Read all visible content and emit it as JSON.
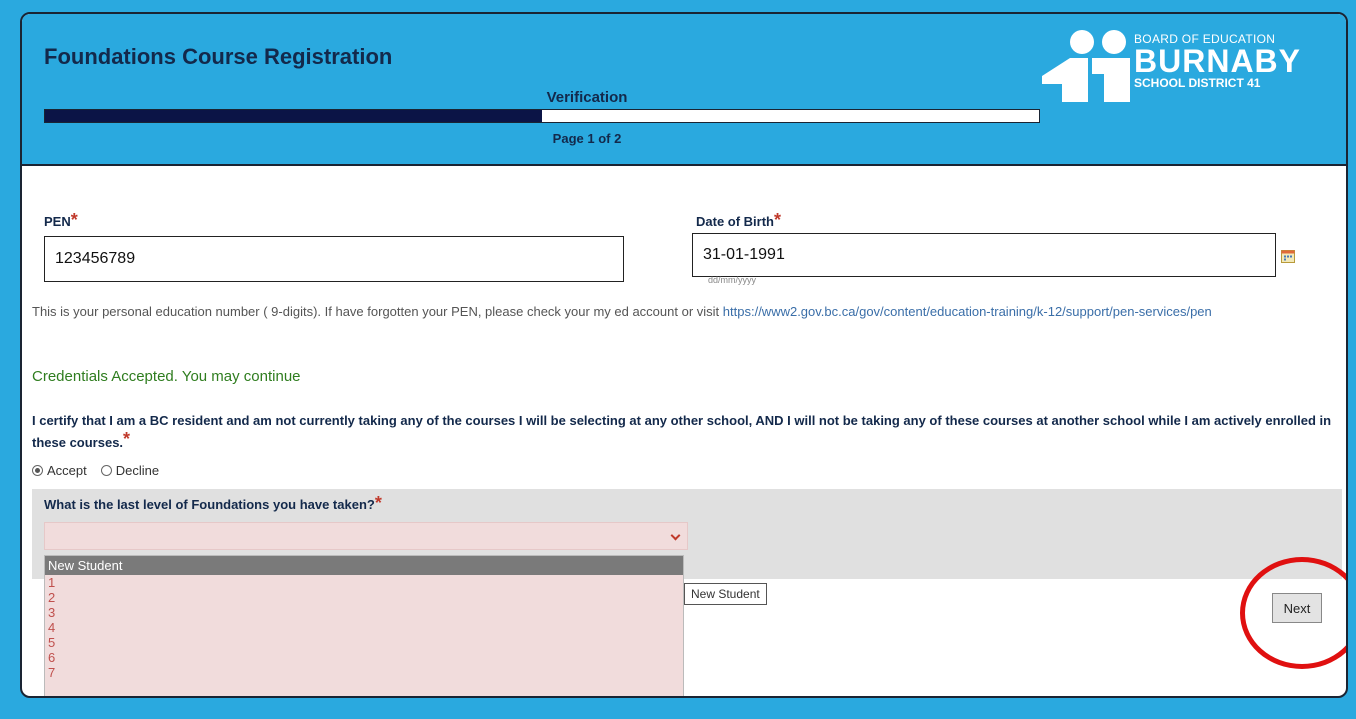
{
  "header": {
    "title": "Foundations Course Registration",
    "step_label": "Verification",
    "progress_fraction": 0.5,
    "page_label": "Page 1 of 2"
  },
  "logo": {
    "line1": "BOARD OF EDUCATION",
    "line2": "BURNABY",
    "line3": "SCHOOL DISTRICT 41"
  },
  "form": {
    "pen": {
      "label": "PEN",
      "required_mark": "*",
      "value": "123456789"
    },
    "dob": {
      "label": "Date of Birth",
      "required_mark": "*",
      "value": "31-01-1991",
      "hint": "dd/mm/yyyy",
      "icon": "calendar-icon"
    },
    "help_text": "This is your personal education number ( 9-digits). If have forgotten your PEN, please check your my ed account or visit ",
    "help_link": "https://www2.gov.bc.ca/gov/content/education-training/k-12/support/pen-services/pen",
    "status_message": "Credentials Accepted. You may continue",
    "certify": {
      "text": "I certify that I am a BC resident and am not currently taking any of the courses I will be selecting at any other school, AND I will not be taking any of these courses at another school while I am actively enrolled in these courses.",
      "required_mark": "*",
      "options": [
        "Accept",
        "Decline"
      ],
      "selected": "Accept"
    },
    "level": {
      "label": "What is the last level of Foundations you have taken?",
      "required_mark": "*",
      "selected_value": "",
      "options": [
        "New Student",
        "1",
        "2",
        "3",
        "4",
        "5",
        "6",
        "7"
      ],
      "highlighted_option": "New Student"
    },
    "tooltip": "New Student",
    "next_label": "Next"
  },
  "colors": {
    "header_bg": "#2aa9df",
    "title": "#13294b",
    "progress_fill": "#0b1446",
    "success": "#2f7d1f",
    "required": "#c0392b",
    "highlight_circle": "#e01010"
  }
}
